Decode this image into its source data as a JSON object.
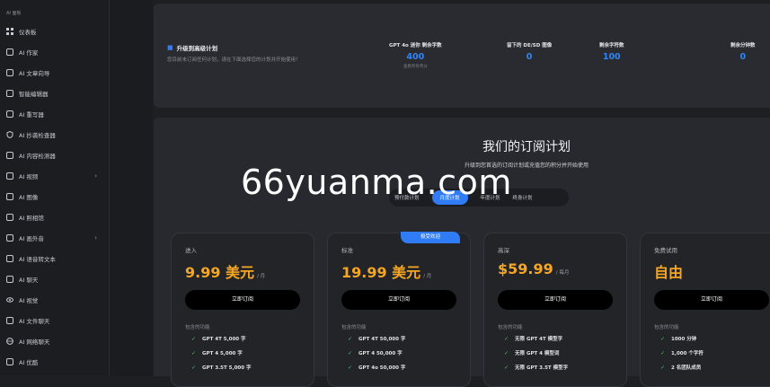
{
  "sidebar": {
    "section_label": "AI 面板",
    "items": [
      {
        "label": "仪表板",
        "icon": "grid-icon",
        "chevron": ""
      },
      {
        "label": "AI 作家",
        "icon": "cog-icon",
        "chevron": ""
      },
      {
        "label": "AI 文章向导",
        "icon": "magic-icon",
        "chevron": ""
      },
      {
        "label": "智能编辑器",
        "icon": "pen-icon",
        "chevron": ""
      },
      {
        "label": "AI 重写器",
        "icon": "edit-icon",
        "chevron": ""
      },
      {
        "label": "AI 抄袭检查器",
        "icon": "shield-icon",
        "chevron": ""
      },
      {
        "label": "AI 内容检测器",
        "icon": "bank-icon",
        "chevron": ""
      },
      {
        "label": "AI 视频",
        "icon": "video-icon",
        "chevron": "›"
      },
      {
        "label": "AI 图像",
        "icon": "image-scan-icon",
        "chevron": ""
      },
      {
        "label": "AI 照相馆",
        "icon": "photo-icon",
        "chevron": ""
      },
      {
        "label": "AI 画外音",
        "icon": "mic-icon",
        "chevron": "›"
      },
      {
        "label": "AI 语音转文本",
        "icon": "waveform-icon",
        "chevron": ""
      },
      {
        "label": "AI 聊天",
        "icon": "chat-icon",
        "chevron": ""
      },
      {
        "label": "AI 视觉",
        "icon": "eye-icon",
        "chevron": ""
      },
      {
        "label": "AI 文件聊天",
        "icon": "file-chat-icon",
        "chevron": ""
      },
      {
        "label": "AI 网络聊天",
        "icon": "globe-icon",
        "chevron": ""
      },
      {
        "label": "AI 优酷",
        "icon": "play-icon",
        "chevron": ""
      }
    ]
  },
  "top_panel": {
    "title": "升级到高级计划",
    "subtitle": "您目前未订阅任何计划，请在下面选择您的计划并开始使用！",
    "stats": [
      {
        "label": "GPT 4o 迷你 剩余字数",
        "value": "400",
        "note": "查看所有积分"
      },
      {
        "label": "留下的 DE/SD 图像",
        "value": "0",
        "note": ""
      },
      {
        "label": "剩余字符数",
        "value": "100",
        "note": ""
      },
      {
        "label": "剩余分钟数",
        "value": "0",
        "note": ""
      }
    ]
  },
  "plans": {
    "heading": "我们的订阅计划",
    "subheading": "升级到您首选的订阅计划或充值您的积分并开始使用",
    "toggle": [
      "预付款计划",
      "月度计划",
      "年度计划",
      "终身计划"
    ],
    "toggle_active": 1,
    "watermark": "66yuanma.com",
    "included_label": "包含的功能",
    "cards": [
      {
        "tier": "进入",
        "price": "9.99 美元",
        "period": "/ 月",
        "button": "立即订阅",
        "badge": "",
        "features": [
          "GPT 4T 5,000 字",
          "GPT 4 5,000 字",
          "GPT 3.5T 5,000 字"
        ]
      },
      {
        "tier": "标准",
        "price": "19.99 美元",
        "period": "/ 月",
        "button": "立即订阅",
        "badge": "极受欢迎",
        "features": [
          "GPT 4T 50,000 字",
          "GPT 4 50,000 字",
          "GPT 4o 50,000 字"
        ]
      },
      {
        "tier": "高深",
        "price": "$59.99",
        "period": "/ 每月",
        "button": "立即订阅",
        "badge": "",
        "features": [
          "无限 GPT 4T 模型字",
          "无限 GPT 4 模型词",
          "无限 GPT 3.5T 模型字"
        ]
      },
      {
        "tier": "免费试用",
        "price": "自由",
        "period": "",
        "button": "立即订阅",
        "badge": "",
        "features": [
          "1000 分钟",
          "1,000 个字符",
          "2 名团队成员"
        ]
      }
    ]
  },
  "colors": {
    "accent": "#2f7cf6",
    "price": "#f5a623",
    "check": "#4fc46d"
  }
}
